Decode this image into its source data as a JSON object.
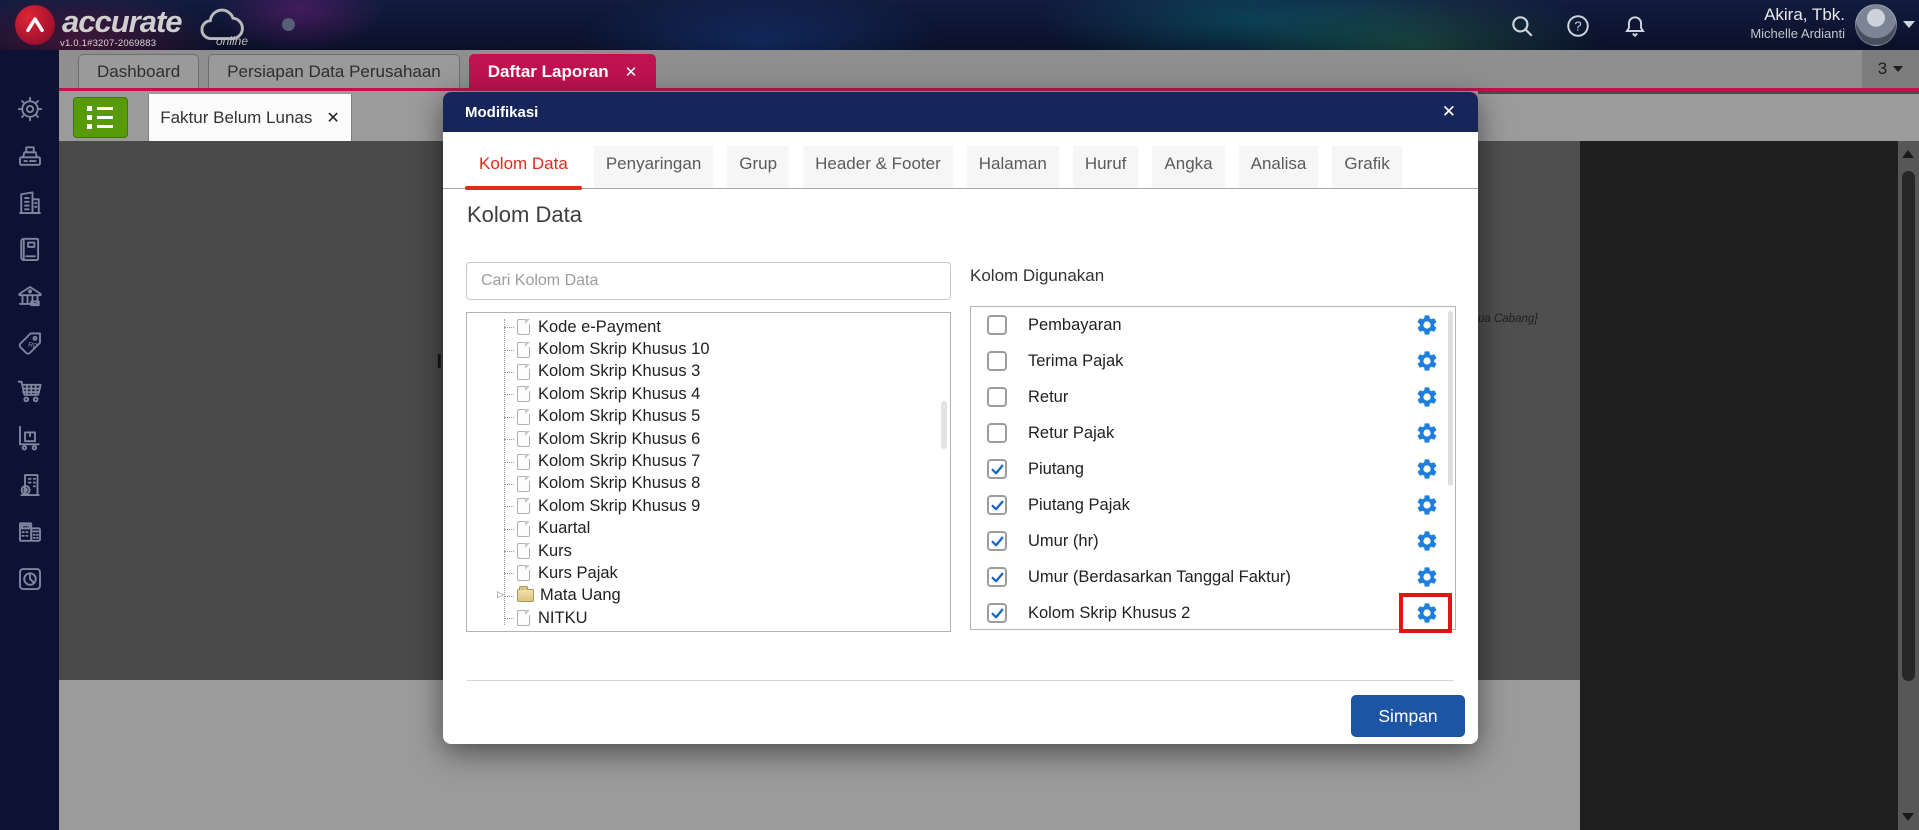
{
  "header": {
    "brand": "accurate",
    "brand_sub": "online",
    "version": "v1.0.1#3207-2069883",
    "company": "Akira, Tbk.",
    "user": "Michelle Ardianti",
    "icons": [
      "search-icon",
      "help-icon",
      "notification-bell-icon"
    ]
  },
  "top_tabs": [
    {
      "label": "Dashboard",
      "active": false,
      "closable": false
    },
    {
      "label": "Persiapan Data Perusahaan",
      "active": false,
      "closable": false
    },
    {
      "label": "Daftar Laporan",
      "active": true,
      "closable": true
    }
  ],
  "tab_overflow_count": "3",
  "sub_tab": {
    "label": "Faktur Belum Lunas",
    "closable": true
  },
  "background_fragments": {
    "left_text": "I",
    "right_text": "ua Cabang]"
  },
  "sidebar_icons": [
    "settings-gear-icon",
    "cash-register-icon",
    "company-building-icon",
    "journal-book-icon",
    "bank-icon",
    "price-tag-rp-icon",
    "shopping-cart-icon",
    "delivery-trolley-icon",
    "office-building-gear-icon",
    "tax-calculator-icon",
    "report-pie-chart-icon"
  ],
  "modal": {
    "title": "Modifikasi",
    "close_glyph": "✕",
    "tabs": [
      "Kolom Data",
      "Penyaringan",
      "Grup",
      "Header & Footer",
      "Halaman",
      "Huruf",
      "Angka",
      "Analisa",
      "Grafik"
    ],
    "active_tab": "Kolom Data",
    "section_title": "Kolom Data",
    "search_placeholder": "Cari Kolom Data",
    "tree_items": [
      {
        "label": "Kode e-Payment",
        "type": "file"
      },
      {
        "label": "Kolom Skrip Khusus 10",
        "type": "file"
      },
      {
        "label": "Kolom Skrip Khusus 3",
        "type": "file"
      },
      {
        "label": "Kolom Skrip Khusus 4",
        "type": "file"
      },
      {
        "label": "Kolom Skrip Khusus 5",
        "type": "file"
      },
      {
        "label": "Kolom Skrip Khusus 6",
        "type": "file"
      },
      {
        "label": "Kolom Skrip Khusus 7",
        "type": "file"
      },
      {
        "label": "Kolom Skrip Khusus 8",
        "type": "file"
      },
      {
        "label": "Kolom Skrip Khusus 9",
        "type": "file"
      },
      {
        "label": "Kuartal",
        "type": "file"
      },
      {
        "label": "Kurs",
        "type": "file"
      },
      {
        "label": "Kurs Pajak",
        "type": "file"
      },
      {
        "label": "Mata Uang",
        "type": "folder",
        "expandable": true
      },
      {
        "label": "NITKU",
        "type": "file"
      }
    ],
    "used_columns_heading": "Kolom Digunakan",
    "used_columns": [
      {
        "label": "Pembayaran",
        "checked": false,
        "highlighted": false
      },
      {
        "label": "Terima Pajak",
        "checked": false,
        "highlighted": false
      },
      {
        "label": "Retur",
        "checked": false,
        "highlighted": false
      },
      {
        "label": "Retur Pajak",
        "checked": false,
        "highlighted": false
      },
      {
        "label": "Piutang",
        "checked": true,
        "highlighted": false
      },
      {
        "label": "Piutang Pajak",
        "checked": true,
        "highlighted": false
      },
      {
        "label": "Umur (hr)",
        "checked": true,
        "highlighted": false
      },
      {
        "label": "Umur (Berdasarkan Tanggal Faktur)",
        "checked": true,
        "highlighted": false
      },
      {
        "label": "Kolom Skrip Khusus 2",
        "checked": true,
        "highlighted": true
      }
    ],
    "save_label": "Simpan"
  },
  "colors": {
    "crimson": "#bf1350",
    "modal_navy": "#16265a",
    "tab_red": "#dd2b1c",
    "gear_blue": "#1f7ddb",
    "check_blue": "#1464c4",
    "save_blue": "#1d55a5",
    "highlight_red": "#e51414",
    "green_btn": "#579b0a"
  }
}
